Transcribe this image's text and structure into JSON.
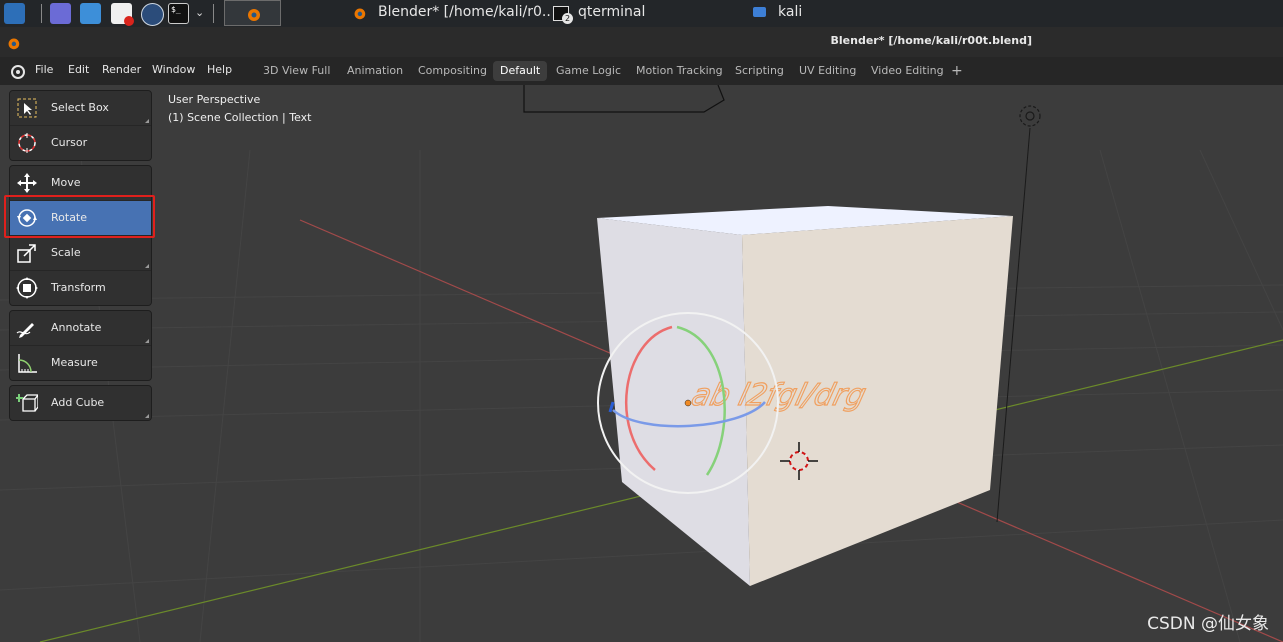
{
  "taskbar": {
    "tasks": [
      {
        "label": "Blender* [/home/kali/r0..."
      },
      {
        "label": "qterminal",
        "badge": "2"
      },
      {
        "label": "kali"
      }
    ]
  },
  "app": {
    "window_title": "Blender* [/home/kali/r00t.blend]"
  },
  "menus": [
    "File",
    "Edit",
    "Render",
    "Window",
    "Help"
  ],
  "workspace_tabs": [
    {
      "label": "3D View Full"
    },
    {
      "label": "Animation"
    },
    {
      "label": "Compositing"
    },
    {
      "label": "Default",
      "active": true
    },
    {
      "label": "Game Logic"
    },
    {
      "label": "Motion Tracking"
    },
    {
      "label": "Scripting"
    },
    {
      "label": "UV Editing"
    },
    {
      "label": "Video Editing"
    },
    {
      "label": "+"
    }
  ],
  "viewport": {
    "view_name": "User Perspective",
    "collection_info": "(1) Scene Collection | Text",
    "text_object": "ab l2fgl/drg"
  },
  "tools": [
    {
      "label": "Select Box",
      "icon": "select-box-icon"
    },
    {
      "label": "Cursor",
      "icon": "cursor-icon"
    },
    {
      "label": "Move",
      "icon": "move-icon"
    },
    {
      "label": "Rotate",
      "icon": "rotate-icon",
      "active": true
    },
    {
      "label": "Scale",
      "icon": "scale-icon"
    },
    {
      "label": "Transform",
      "icon": "transform-icon"
    },
    {
      "label": "Annotate",
      "icon": "annotate-icon"
    },
    {
      "label": "Measure",
      "icon": "measure-icon"
    },
    {
      "label": "Add Cube",
      "icon": "add-cube-icon"
    }
  ],
  "watermark": "CSDN @仙女象",
  "colors": {
    "active_tool": "#4772b3",
    "highlight_box": "#e0201c",
    "x_axis": "#b84b4b",
    "y_axis": "#6f8f2a"
  }
}
